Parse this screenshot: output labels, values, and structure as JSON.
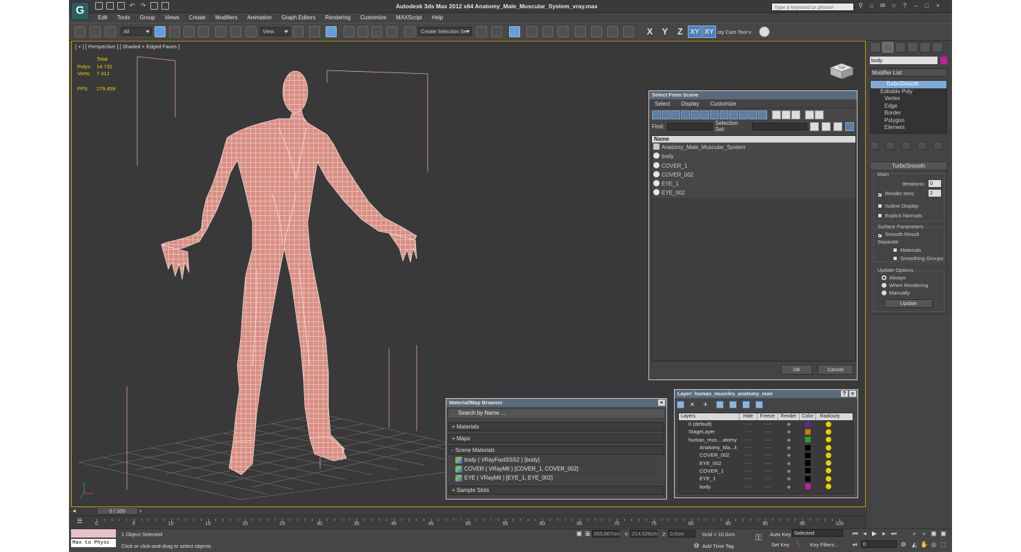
{
  "app": {
    "title": "Autodesk 3ds Max  2012 x64      Anatomy_Male_Muscular_System_vray.max",
    "search_placeholder": "Type a keyword or phrase"
  },
  "menu": [
    "Edit",
    "Tools",
    "Group",
    "Views",
    "Create",
    "Modifiers",
    "Animation",
    "Graph Editors",
    "Rendering",
    "Customize",
    "MAXScript",
    "Help"
  ],
  "toolbar": {
    "filter_value": "All",
    "refcoord_value": "View",
    "selection_set_value": "Create Selection Se",
    "axes": [
      "X",
      "Y",
      "Z",
      "XY",
      "XY"
    ],
    "cam_tool_label": "sty Cam Tool v"
  },
  "viewport": {
    "label": "[ + ] [ Perspective ] [ Shaded + Edged Faces ]",
    "stats": {
      "total_label": "Total",
      "polys_label": "Polys:",
      "polys": "14 732",
      "verts_label": "Verts:",
      "verts": "7 412",
      "fps_label": "FPS:",
      "fps": "279,459"
    },
    "viewcube_label": "TOP"
  },
  "select_from_scene": {
    "title": "Select From Scene",
    "menu": [
      "Select",
      "Display",
      "Customize"
    ],
    "find_label": "Find:",
    "selection_set_label": "Selection Set:",
    "column_name": "Name",
    "rows": [
      "Anatomy_Male_Muscular_System",
      "body",
      "COVER_1",
      "COVER_002",
      "EYE_1",
      "EYE_002"
    ],
    "ok": "OK",
    "cancel": "Cancel"
  },
  "material_browser": {
    "title": "Material/Map Browser",
    "search_placeholder": "Search by Name ...",
    "sections": {
      "materials": "+ Materials",
      "maps": "+ Maps",
      "scene": "- Scene Materials",
      "samples": "+ Sample Slots"
    },
    "scene_items": [
      "body  ( VRayFastSSS2 ) [body]",
      "COVER  ( VRayMtl ) [COVER_1, COVER_002]",
      "EYE  ( VRayMtl ) [EYE_1, EYE_002]"
    ]
  },
  "layer_dialog": {
    "title": "Layer: human_muscles_anatomy_man",
    "columns": [
      "Layers",
      "Hide",
      "Freeze",
      "Render",
      "Color",
      "Radiosity"
    ],
    "dash": "----",
    "rows": [
      {
        "name": "0 (default)",
        "color": "#5a2aa0"
      },
      {
        "name": "StageLayer",
        "color": "#d07a00"
      },
      {
        "name": "human_mus....atomy",
        "color": "#2aa02a"
      },
      {
        "name": "Anatomy_Ma...li",
        "color": "#000000"
      },
      {
        "name": "COVER_002",
        "color": "#000000"
      },
      {
        "name": "EYE_002",
        "color": "#000000"
      },
      {
        "name": "COVER_1",
        "color": "#000000"
      },
      {
        "name": "EYE_1",
        "color": "#000000"
      },
      {
        "name": "body",
        "color": "#c21ea0"
      }
    ]
  },
  "command_panel": {
    "object_name": "body",
    "object_color": "#c21ea0",
    "modifier_list": "Modifier List",
    "stack": {
      "turbosmooth": "TurboSmooth",
      "editable_poly": "Editable Poly",
      "subs": [
        "Vertex",
        "Edge",
        "Border",
        "Polygon",
        "Element"
      ]
    },
    "rollout": {
      "title": "TurboSmooth",
      "main": "Main",
      "iterations_label": "Iterations:",
      "iterations": "0",
      "render_iters_label": "Render Iters:",
      "render_iters": "2",
      "isoline": "Isoline Display",
      "explicit": "Explicit Normals",
      "surface_params": "Surface Parameters",
      "smooth_result": "Smooth Result",
      "separate": "Separate",
      "materials": "Materials",
      "smoothing_groups": "Smoothing Groups",
      "update_options": "Update Options",
      "always": "Always",
      "when_rendering": "When Rendering",
      "manually": "Manually",
      "update_btn": "Update"
    }
  },
  "timeline": {
    "slider": "0 / 100",
    "labels": [
      "0",
      "5",
      "10",
      "15",
      "20",
      "25",
      "30",
      "35",
      "40",
      "45",
      "50",
      "55",
      "60",
      "65",
      "70",
      "75",
      "80",
      "85",
      "90",
      "95",
      "100"
    ]
  },
  "status": {
    "maxscript": "Max to Physc",
    "selected": "1 Object Selected",
    "prompt": "Click or click-and-drag to select objects",
    "x_label": "X:",
    "x": "655,667cm",
    "y_label": "Y:",
    "y": "214,526cm",
    "z_label": "Z:",
    "z": "0,0cm",
    "grid": "Grid = 10,0cm",
    "add_time_tag": "Add Time Tag",
    "auto_key": "Auto Key",
    "selected_dd": "Selected",
    "set_key": "Set Key",
    "key_filters": "Key Filters...",
    "frame": "0"
  }
}
